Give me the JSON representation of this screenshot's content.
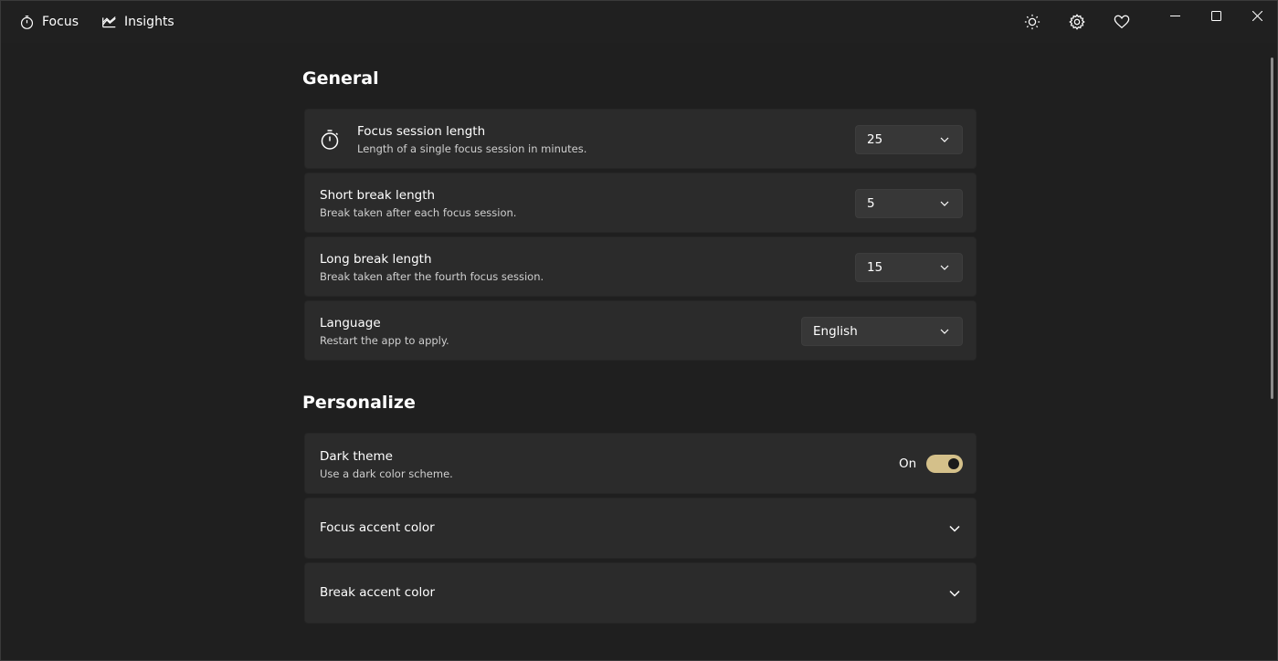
{
  "nav": {
    "focus_label": "Focus",
    "insights_label": "Insights"
  },
  "icons": {
    "theme": "sun-icon",
    "settings": "gear-icon",
    "support": "heart-icon",
    "minimize": "minimize-icon",
    "maximize": "maximize-icon",
    "close": "close-icon"
  },
  "sections": {
    "general": "General",
    "personalize": "Personalize"
  },
  "general": {
    "focus_length": {
      "title": "Focus session length",
      "subtitle": "Length of a single focus session in minutes.",
      "value": "25"
    },
    "short_break": {
      "title": "Short break length",
      "subtitle": "Break taken after each focus session.",
      "value": "5"
    },
    "long_break": {
      "title": "Long break length",
      "subtitle": "Break taken after the fourth focus session.",
      "value": "15"
    },
    "language": {
      "title": "Language",
      "subtitle": "Restart the app to apply.",
      "value": "English"
    }
  },
  "personalize": {
    "dark_theme": {
      "title": "Dark theme",
      "subtitle": "Use a dark color scheme.",
      "state_label": "On",
      "on": true
    },
    "focus_accent": {
      "title": "Focus accent color"
    },
    "break_accent": {
      "title": "Break accent color"
    }
  },
  "colors": {
    "background": "#1f1f1f",
    "card": "#2b2b2b",
    "dropdown": "#373737",
    "accent": "#d4c08a"
  }
}
